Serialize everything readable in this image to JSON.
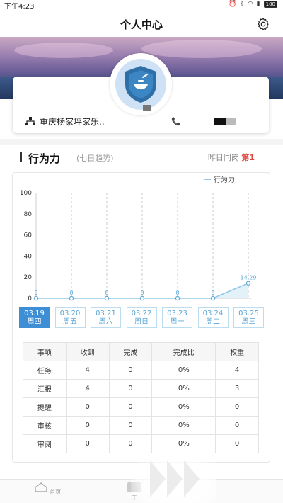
{
  "status_bar": {
    "time": "下午4:23",
    "battery": "100"
  },
  "header": {
    "title": "个人中心",
    "settings_icon": "gear-icon"
  },
  "profile": {
    "org": "重庆杨家坪家乐..",
    "org_icon": "org-chart-icon",
    "phone_icon": "phone-icon"
  },
  "behavior": {
    "title": "行为力",
    "subtitle": "(七日趋势)",
    "rank_prefix": "昨日同岗",
    "rank_value": "第1"
  },
  "chart_data": {
    "type": "area",
    "legend": [
      "行为力"
    ],
    "y_ticks": [
      0,
      20,
      40,
      60,
      80,
      100
    ],
    "ylim": [
      0,
      100
    ],
    "categories": [
      "03.19",
      "03.20",
      "03.21",
      "03.22",
      "03.23",
      "03.24",
      "03.25"
    ],
    "series": [
      {
        "name": "行为力",
        "values": [
          0,
          0,
          0,
          0,
          0,
          0,
          14.29
        ]
      }
    ],
    "data_labels": [
      "0",
      "0",
      "0",
      "0",
      "0",
      "0",
      "14.29"
    ],
    "grid": "vertical dashed",
    "color": "#8fc9e8"
  },
  "date_tabs": [
    {
      "date": "03.19",
      "weekday": "周四",
      "active": true
    },
    {
      "date": "03.20",
      "weekday": "周五",
      "active": false
    },
    {
      "date": "03.21",
      "weekday": "周六",
      "active": false
    },
    {
      "date": "03.22",
      "weekday": "周日",
      "active": false
    },
    {
      "date": "03.23",
      "weekday": "周一",
      "active": false
    },
    {
      "date": "03.24",
      "weekday": "周二",
      "active": false
    },
    {
      "date": "03.25",
      "weekday": "周三",
      "active": false
    }
  ],
  "table": {
    "headers": [
      "事项",
      "收到",
      "完成",
      "完成比",
      "权重"
    ],
    "rows": [
      [
        "任务",
        "4",
        "0",
        "0%",
        "4"
      ],
      [
        "汇报",
        "4",
        "0",
        "0%",
        "3"
      ],
      [
        "提醒",
        "0",
        "0",
        "0%",
        "0"
      ],
      [
        "审核",
        "0",
        "0",
        "0%",
        "0"
      ],
      [
        "审阅",
        "0",
        "0",
        "0%",
        "0"
      ]
    ]
  },
  "tabbar": {
    "home_label": "首页",
    "second_label": "工"
  }
}
